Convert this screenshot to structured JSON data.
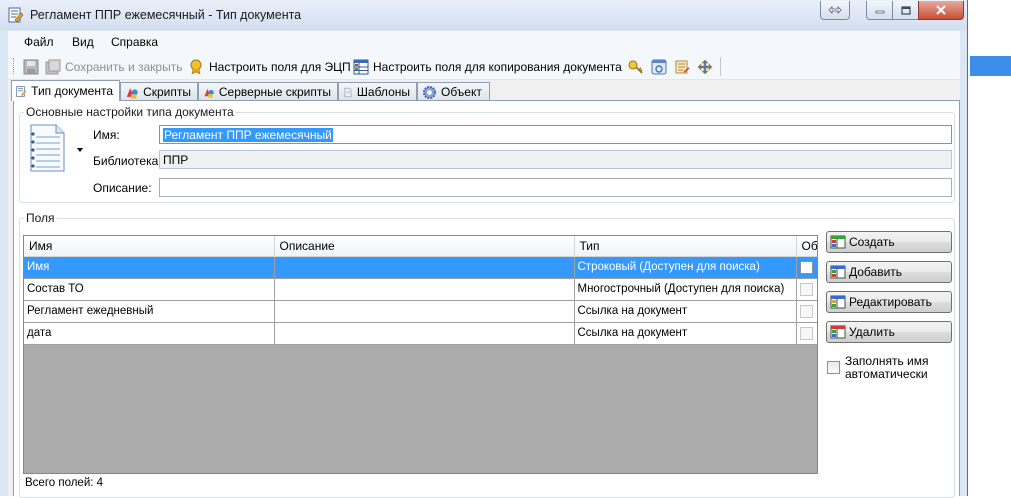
{
  "window": {
    "title": "Регламент ППР ежемесячный - Тип документа"
  },
  "menu": [
    "Файл",
    "Вид",
    "Справка"
  ],
  "toolbar": {
    "save_close": "Сохранить и закрыть",
    "ecp_fields": "Настроить поля для ЭЦП",
    "copy_fields": "Настроить поля для копирования документа"
  },
  "tabs": [
    "Тип документа",
    "Скрипты",
    "Серверные скрипты",
    "Шаблоны",
    "Объект"
  ],
  "settings": {
    "group_title": "Основные настройки типа документа",
    "name_label": "Имя:",
    "name_value": "Регламент ППР ежемесячный",
    "library_label": "Библиотека:",
    "library_value": "ППР",
    "description_label": "Описание:",
    "description_value": ""
  },
  "fields": {
    "group_title": "Поля",
    "columns": [
      "Имя",
      "Описание",
      "Тип",
      "Об"
    ],
    "rows": [
      {
        "name": "Имя",
        "description": "",
        "type": "Строковый (Доступен для поиска)",
        "required": false
      },
      {
        "name": "Состав ТО",
        "description": "",
        "type": "Многострочный (Доступен для поиска)",
        "required": false
      },
      {
        "name": "Регламент ежедневный",
        "description": "",
        "type": "Ссылка на документ",
        "required": false
      },
      {
        "name": "дата",
        "description": "",
        "type": "Ссылка на документ",
        "required": false
      }
    ],
    "buttons": {
      "create": "Создать",
      "add": "Добавить",
      "edit": "Редактировать",
      "delete": "Удалить"
    },
    "auto_name_label": "Заполнять имя автоматически",
    "total_label": "Всего полей: 4"
  },
  "colors": {
    "selection": "#3399ff",
    "window_frame": "#dbe6f4",
    "grid_empty": "#ababab"
  }
}
